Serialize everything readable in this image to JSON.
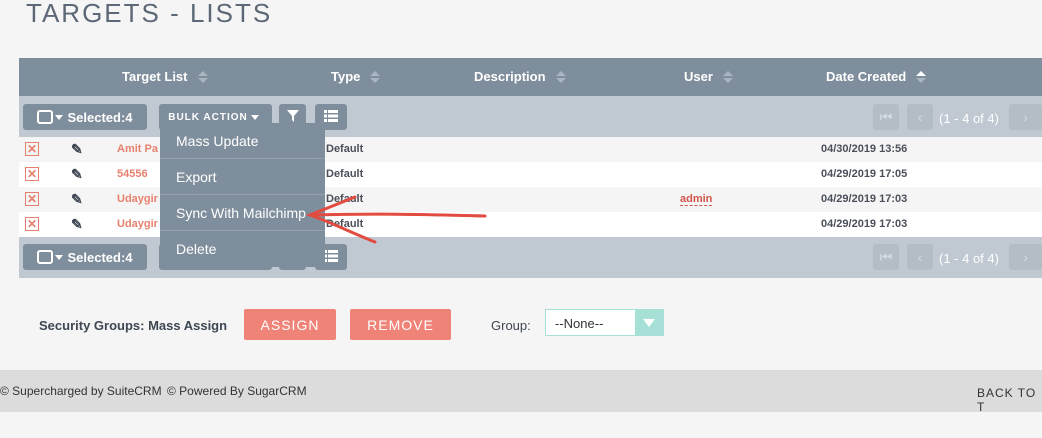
{
  "page": {
    "title": "TARGETS - LISTS"
  },
  "table": {
    "columns": [
      "Target List",
      "Type",
      "Description",
      "User",
      "Date Created"
    ],
    "rows": [
      {
        "name": "Amit Pa",
        "type": "Default",
        "user": "",
        "date": "04/30/2019 13:56"
      },
      {
        "name": "54556",
        "type": "Default",
        "user": "",
        "date": "04/29/2019 17:05"
      },
      {
        "name": "Udaygir",
        "type": "Default",
        "user": "admin",
        "date": "04/29/2019 17:03"
      },
      {
        "name": "Udaygir",
        "type": "Default",
        "user": "",
        "date": "04/29/2019 17:03"
      }
    ]
  },
  "toolbar": {
    "selected_label": "Selected:4",
    "bulk_action_label": "BULK ACTION",
    "pagination": "(1 - 4 of 4)"
  },
  "bulk_menu": {
    "items": [
      "Mass Update",
      "Export",
      "Sync With Mailchimp",
      "Delete"
    ]
  },
  "security_groups": {
    "label": "Security Groups: Mass Assign",
    "assign_label": "ASSIGN",
    "remove_label": "REMOVE",
    "group_label": "Group:",
    "group_value": "--None--"
  },
  "footer": {
    "supercharged": "© Supercharged by SuiteCRM",
    "powered": "© Powered By SugarCRM",
    "back_to_top": "BACK TO T"
  },
  "colors": {
    "accent": "#f08377",
    "header": "#7f8e9c",
    "teal": "#a6e0d7"
  }
}
